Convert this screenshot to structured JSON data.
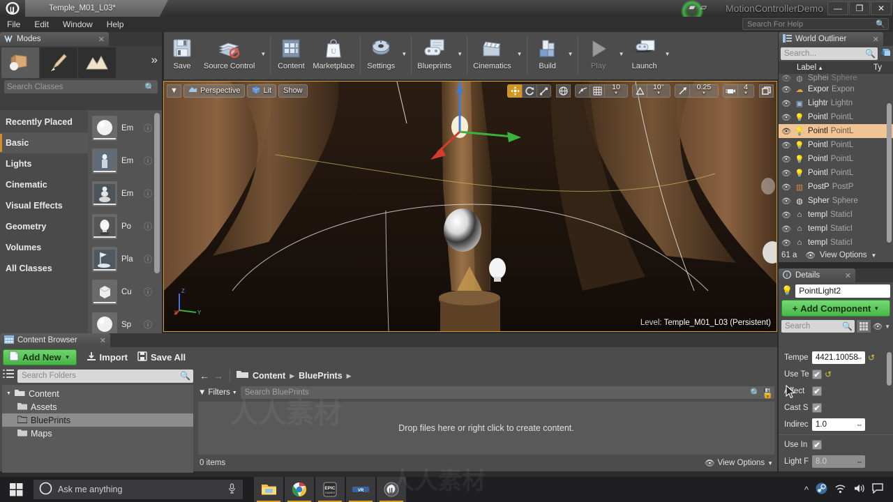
{
  "titlebar": {
    "tab_label": "Temple_M01_L03*",
    "project_title": "MotionControllerDemo",
    "minimize": "—",
    "maximize": "❐",
    "close": "✕"
  },
  "menubar": {
    "items": [
      "File",
      "Edit",
      "Window",
      "Help"
    ],
    "help_search_placeholder": "Search For Help"
  },
  "toolbar": {
    "buttons": [
      {
        "label": "Save",
        "icon": "floppy-disk-icon",
        "dropdown": false,
        "disabled": false
      },
      {
        "label": "Source Control",
        "icon": "source-control-icon",
        "dropdown": true,
        "disabled": false
      },
      {
        "label": "Content",
        "icon": "content-grid-icon",
        "dropdown": false,
        "disabled": false
      },
      {
        "label": "Marketplace",
        "icon": "marketplace-bag-icon",
        "dropdown": false,
        "disabled": false
      },
      {
        "label": "Settings",
        "icon": "gear-icon",
        "dropdown": true,
        "disabled": false
      },
      {
        "label": "Blueprints",
        "icon": "blueprint-icon",
        "dropdown": true,
        "disabled": false
      },
      {
        "label": "Cinematics",
        "icon": "clapperboard-icon",
        "dropdown": true,
        "disabled": false
      },
      {
        "label": "Build",
        "icon": "build-blocks-icon",
        "dropdown": true,
        "disabled": false
      },
      {
        "label": "Play",
        "icon": "play-triangle-icon",
        "dropdown": true,
        "disabled": true
      },
      {
        "label": "Launch",
        "icon": "launch-gamepad-icon",
        "dropdown": true,
        "disabled": false
      }
    ]
  },
  "modes": {
    "tab_label": "Modes",
    "mode_icons": [
      "place-mode-icon",
      "paint-mode-icon",
      "landscape-mode-icon"
    ],
    "more_icon": "chevron-double-right-icon",
    "search_placeholder": "Search Classes",
    "categories": [
      "Recently Placed",
      "Basic",
      "Lights",
      "Cinematic",
      "Visual Effects",
      "Geometry",
      "Volumes",
      "All Classes"
    ],
    "active_category": "Basic",
    "assets": [
      {
        "name": "Em",
        "thumb": "sphere-thumb"
      },
      {
        "name": "Em",
        "thumb": "player-start-thumb"
      },
      {
        "name": "Em",
        "thumb": "pawn-thumb"
      },
      {
        "name": "Po",
        "thumb": "point-light-thumb"
      },
      {
        "name": "Pla",
        "thumb": "player-start-thumb"
      },
      {
        "name": "Cu",
        "thumb": "cube-thumb"
      },
      {
        "name": "Sp",
        "thumb": "sphere-thumb"
      }
    ],
    "help_icon": "question-circle-icon"
  },
  "viewport": {
    "camera_menu_icon": "chevron-down-icon",
    "perspective_label": "Perspective",
    "lit_label": "Lit",
    "show_label": "Show",
    "transform_tools": [
      "select-move-icon",
      "rotate-icon",
      "scale-icon"
    ],
    "coord_system_icon": "globe-icon",
    "snap_surface_icon": "surface-snap-icon",
    "grid_snap_icon": "grid-icon",
    "grid_snap_value": "10",
    "rotation_snap_icon": "angle-icon",
    "rotation_snap_value": "10°",
    "scale_snap_icon": "scale-arrow-icon",
    "scale_snap_value": "0.25",
    "camera_speed_icon": "camera-icon",
    "camera_speed_value": "4",
    "maximize_icon": "maximize-viewport-icon",
    "level_prefix": "Level:",
    "level_name": "Temple_M01_L03 (Persistent)",
    "axis_labels": [
      "Z",
      "Y",
      "X"
    ]
  },
  "outliner": {
    "tab_label": "World Outliner",
    "search_placeholder": "Search...",
    "add_icon": "add-actor-icon",
    "columns": {
      "label": "Label",
      "type": "Ty"
    },
    "sort_asc_icon": "caret-up-icon",
    "sort_menu_icon": "caret-down-icon",
    "rows": [
      {
        "label": "Sphei",
        "type": "Sphere",
        "icon": "sphere-reflection-icon",
        "selected": false,
        "partial": true
      },
      {
        "label": "Expor",
        "type": "Expon",
        "icon": "exponential-fog-icon",
        "selected": false
      },
      {
        "label": "Lightr",
        "type": "Lightn",
        "icon": "lightmass-icon",
        "selected": false
      },
      {
        "label": "Pointl",
        "type": "PointL",
        "icon": "point-light-icon",
        "selected": false
      },
      {
        "label": "Pointl",
        "type": "PointL",
        "icon": "point-light-icon",
        "selected": true
      },
      {
        "label": "Pointl",
        "type": "PointL",
        "icon": "point-light-icon",
        "selected": false
      },
      {
        "label": "Pointl",
        "type": "PointL",
        "icon": "point-light-icon",
        "selected": false
      },
      {
        "label": "Pointl",
        "type": "PointL",
        "icon": "point-light-icon",
        "selected": false
      },
      {
        "label": "PostP",
        "type": "PostP",
        "icon": "post-process-icon",
        "selected": false
      },
      {
        "label": "Spher",
        "type": "Sphere",
        "icon": "sphere-reflection-icon",
        "selected": false
      },
      {
        "label": "templ",
        "type": "StaticI",
        "icon": "static-mesh-icon",
        "selected": false
      },
      {
        "label": "templ",
        "type": "StaticI",
        "icon": "static-mesh-icon",
        "selected": false
      },
      {
        "label": "templ",
        "type": "StaticI",
        "icon": "static-mesh-icon",
        "selected": false
      }
    ],
    "footer_count": "61 a",
    "view_options": "View Options",
    "eye_icon": "eye-icon"
  },
  "details": {
    "tab_label": "Details",
    "actor_icon": "point-light-icon",
    "actor_name": "PointLight2",
    "add_component_label": "Add Component",
    "search_placeholder": "Search",
    "grid_view_icon": "grid-view-icon",
    "display_options_icon": "eye-icon",
    "properties": [
      {
        "label": "Tempe",
        "type": "number",
        "value": "4421.10058",
        "revert": true
      },
      {
        "label": "Use Te",
        "type": "checkbox",
        "value": "✔",
        "revert": true
      },
      {
        "label": "Affect",
        "type": "checkbox",
        "value": "✔",
        "revert": false
      },
      {
        "label": "Cast S",
        "type": "checkbox",
        "value": "✔",
        "revert": false
      },
      {
        "label": "Indirec",
        "type": "number",
        "value": "1.0",
        "revert": false
      },
      {
        "label": "Use In",
        "type": "checkbox",
        "value": "✔",
        "revert": false
      },
      {
        "label": "Light F",
        "type": "number",
        "value": "8.0",
        "dim": true,
        "revert": false
      }
    ]
  },
  "content_browser": {
    "tab_label": "Content Browser",
    "add_new_label": "Add New",
    "import_label": "Import",
    "save_all_label": "Save All",
    "folders_search_placeholder": "Search Folders",
    "folder_tree": [
      {
        "label": "Content",
        "level": 0,
        "selected": false,
        "expanded": true
      },
      {
        "label": "Assets",
        "level": 1,
        "selected": false
      },
      {
        "label": "BluePrints",
        "level": 1,
        "selected": true
      },
      {
        "label": "Maps",
        "level": 1,
        "selected": false
      }
    ],
    "breadcrumbs": [
      "Content",
      "BluePrints"
    ],
    "back_icon": "arrow-left-icon",
    "forward_icon": "arrow-right-icon",
    "filters_label": "Filters",
    "asset_search_placeholder": "Search BluePrints",
    "save_search_icon": "save-search-icon",
    "lock_icon": "lock-icon",
    "empty_message": "Drop files here or right click to create content.",
    "item_count": "0 items",
    "view_options": "View Options"
  },
  "taskbar": {
    "start_icon": "windows-start-icon",
    "cortana_placeholder": "Ask me anything",
    "mic_icon": "microphone-icon",
    "apps": [
      {
        "name": "file-explorer-icon",
        "active": true
      },
      {
        "name": "chrome-icon",
        "active": true
      },
      {
        "name": "epic-games-icon",
        "active": true
      },
      {
        "name": "vr-icon",
        "active": true
      },
      {
        "name": "unreal-engine-icon",
        "active": true
      }
    ],
    "tray_icons": [
      "show-hidden-icons-icon",
      "steam-icon",
      "network-icon",
      "volume-icon",
      "action-center-icon"
    ]
  },
  "colors": {
    "accent_orange": "#d09a34",
    "green_button": "#47b847",
    "selection_highlight": "#f0c394",
    "panel_bg": "#4c4c4c",
    "dark_bg": "#383838"
  }
}
